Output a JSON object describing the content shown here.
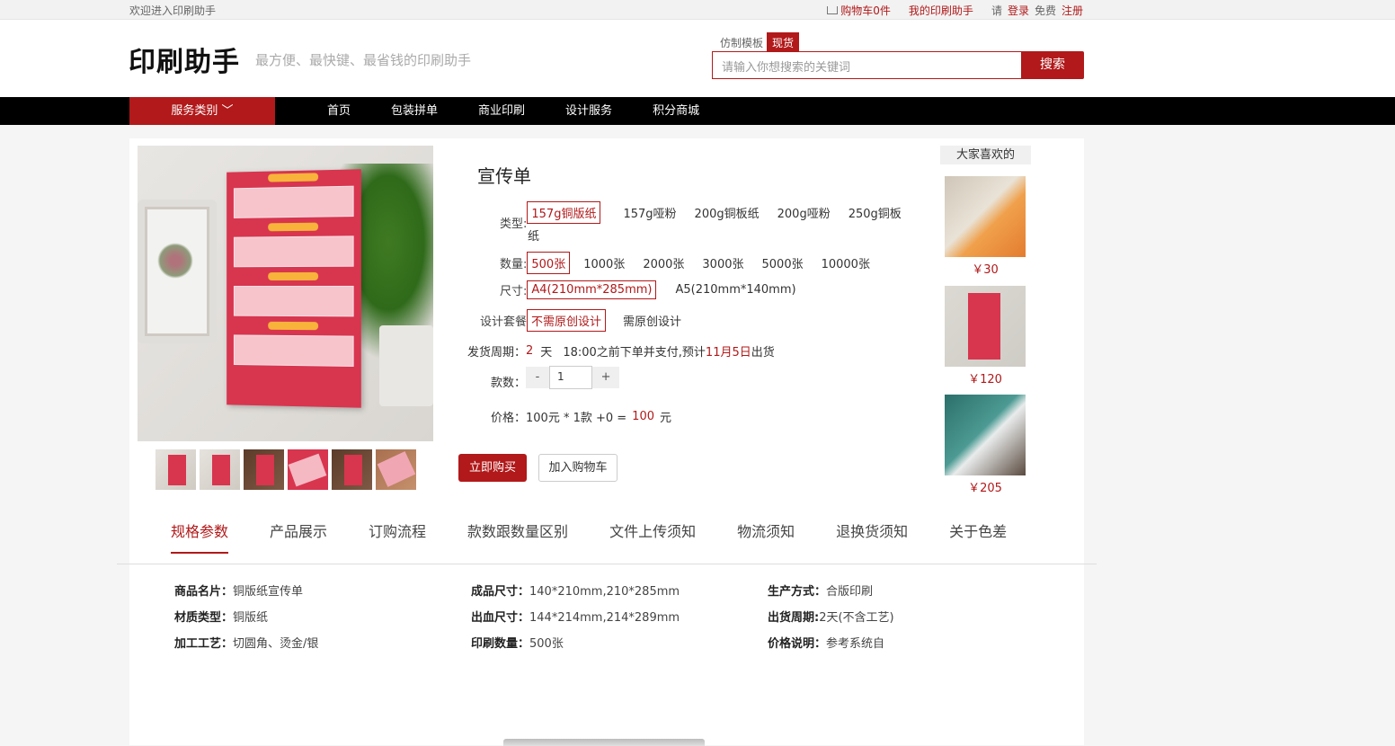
{
  "topbar": {
    "welcome": "欢迎进入印刷助手",
    "cart": "购物车0件",
    "my": "我的印刷助手",
    "please": "请",
    "login": "登录",
    "free": "免费",
    "register": "注册"
  },
  "header": {
    "logo": "印刷助手",
    "slogan": "最方便、最快键、最省钱的印刷助手",
    "search_tabs": [
      "仿制模板",
      "现货"
    ],
    "search_placeholder": "请输入你想搜索的关键词",
    "search_button": "搜索"
  },
  "nav": {
    "category": "服务类别 ﹀",
    "links": [
      "首页",
      "包装拼单",
      "商业印刷",
      "设计服务",
      "积分商城"
    ]
  },
  "product": {
    "title": "宣传单",
    "type_label": "类型:",
    "types": [
      "157g铜版纸",
      "157g哑粉",
      "200g铜板纸",
      "200g哑粉",
      "250g铜板"
    ],
    "type_wrap": "纸",
    "qty_label": "数量:",
    "qtys": [
      "500张",
      "1000张",
      "2000张",
      "3000张",
      "5000张",
      "10000张"
    ],
    "size_label": "尺寸:",
    "sizes": [
      "A4(210mm*285mm)",
      "A5(210mm*140mm)"
    ],
    "design_label": "设计套餐",
    "designs": [
      "不需原创设计",
      "需原创设计"
    ],
    "ship_label": "发货周期：",
    "ship_days": "2",
    "ship_unit": "天",
    "ship_note_a": "18:00之前下单并支付,预计",
    "ship_date": "11月5日",
    "ship_note_b": "出货",
    "count_label": "款数：",
    "minus": "-",
    "count_value": "1",
    "plus": "+",
    "price_label": "价格：100元 * 1款 +0 =",
    "price_value": "100",
    "price_unit": "元",
    "buy_now": "立即购买",
    "add_cart": "加入购物车"
  },
  "side": {
    "title": "大家喜欢的",
    "items": [
      {
        "price": "￥30"
      },
      {
        "price": "￥120"
      },
      {
        "price": "￥205"
      }
    ]
  },
  "tabs": [
    "规格参数",
    "产品展示",
    "订购流程",
    "款数跟数量区别",
    "文件上传须知",
    "物流须知",
    "退换货须知",
    "关于色差"
  ],
  "specs": [
    {
      "label": "商品名片：",
      "value": "铜版纸宣传单"
    },
    {
      "label": "成品尺寸：",
      "value": "140*210mm,210*285mm"
    },
    {
      "label": "生产方式：",
      "value": "合版印刷"
    },
    {
      "label": "材质类型：",
      "value": "铜版纸"
    },
    {
      "label": "出血尺寸：",
      "value": "144*214mm,214*289mm"
    },
    {
      "label": "出货周期:",
      "value": "2天(不含工艺)"
    },
    {
      "label": "加工工艺：",
      "value": "切圆角、烫金/银"
    },
    {
      "label": "印刷数量：",
      "value": "500张"
    },
    {
      "label": "价格说明：",
      "value": "参考系统自"
    }
  ],
  "colors": {
    "accent": "#b1191a",
    "nav": "#000000"
  }
}
